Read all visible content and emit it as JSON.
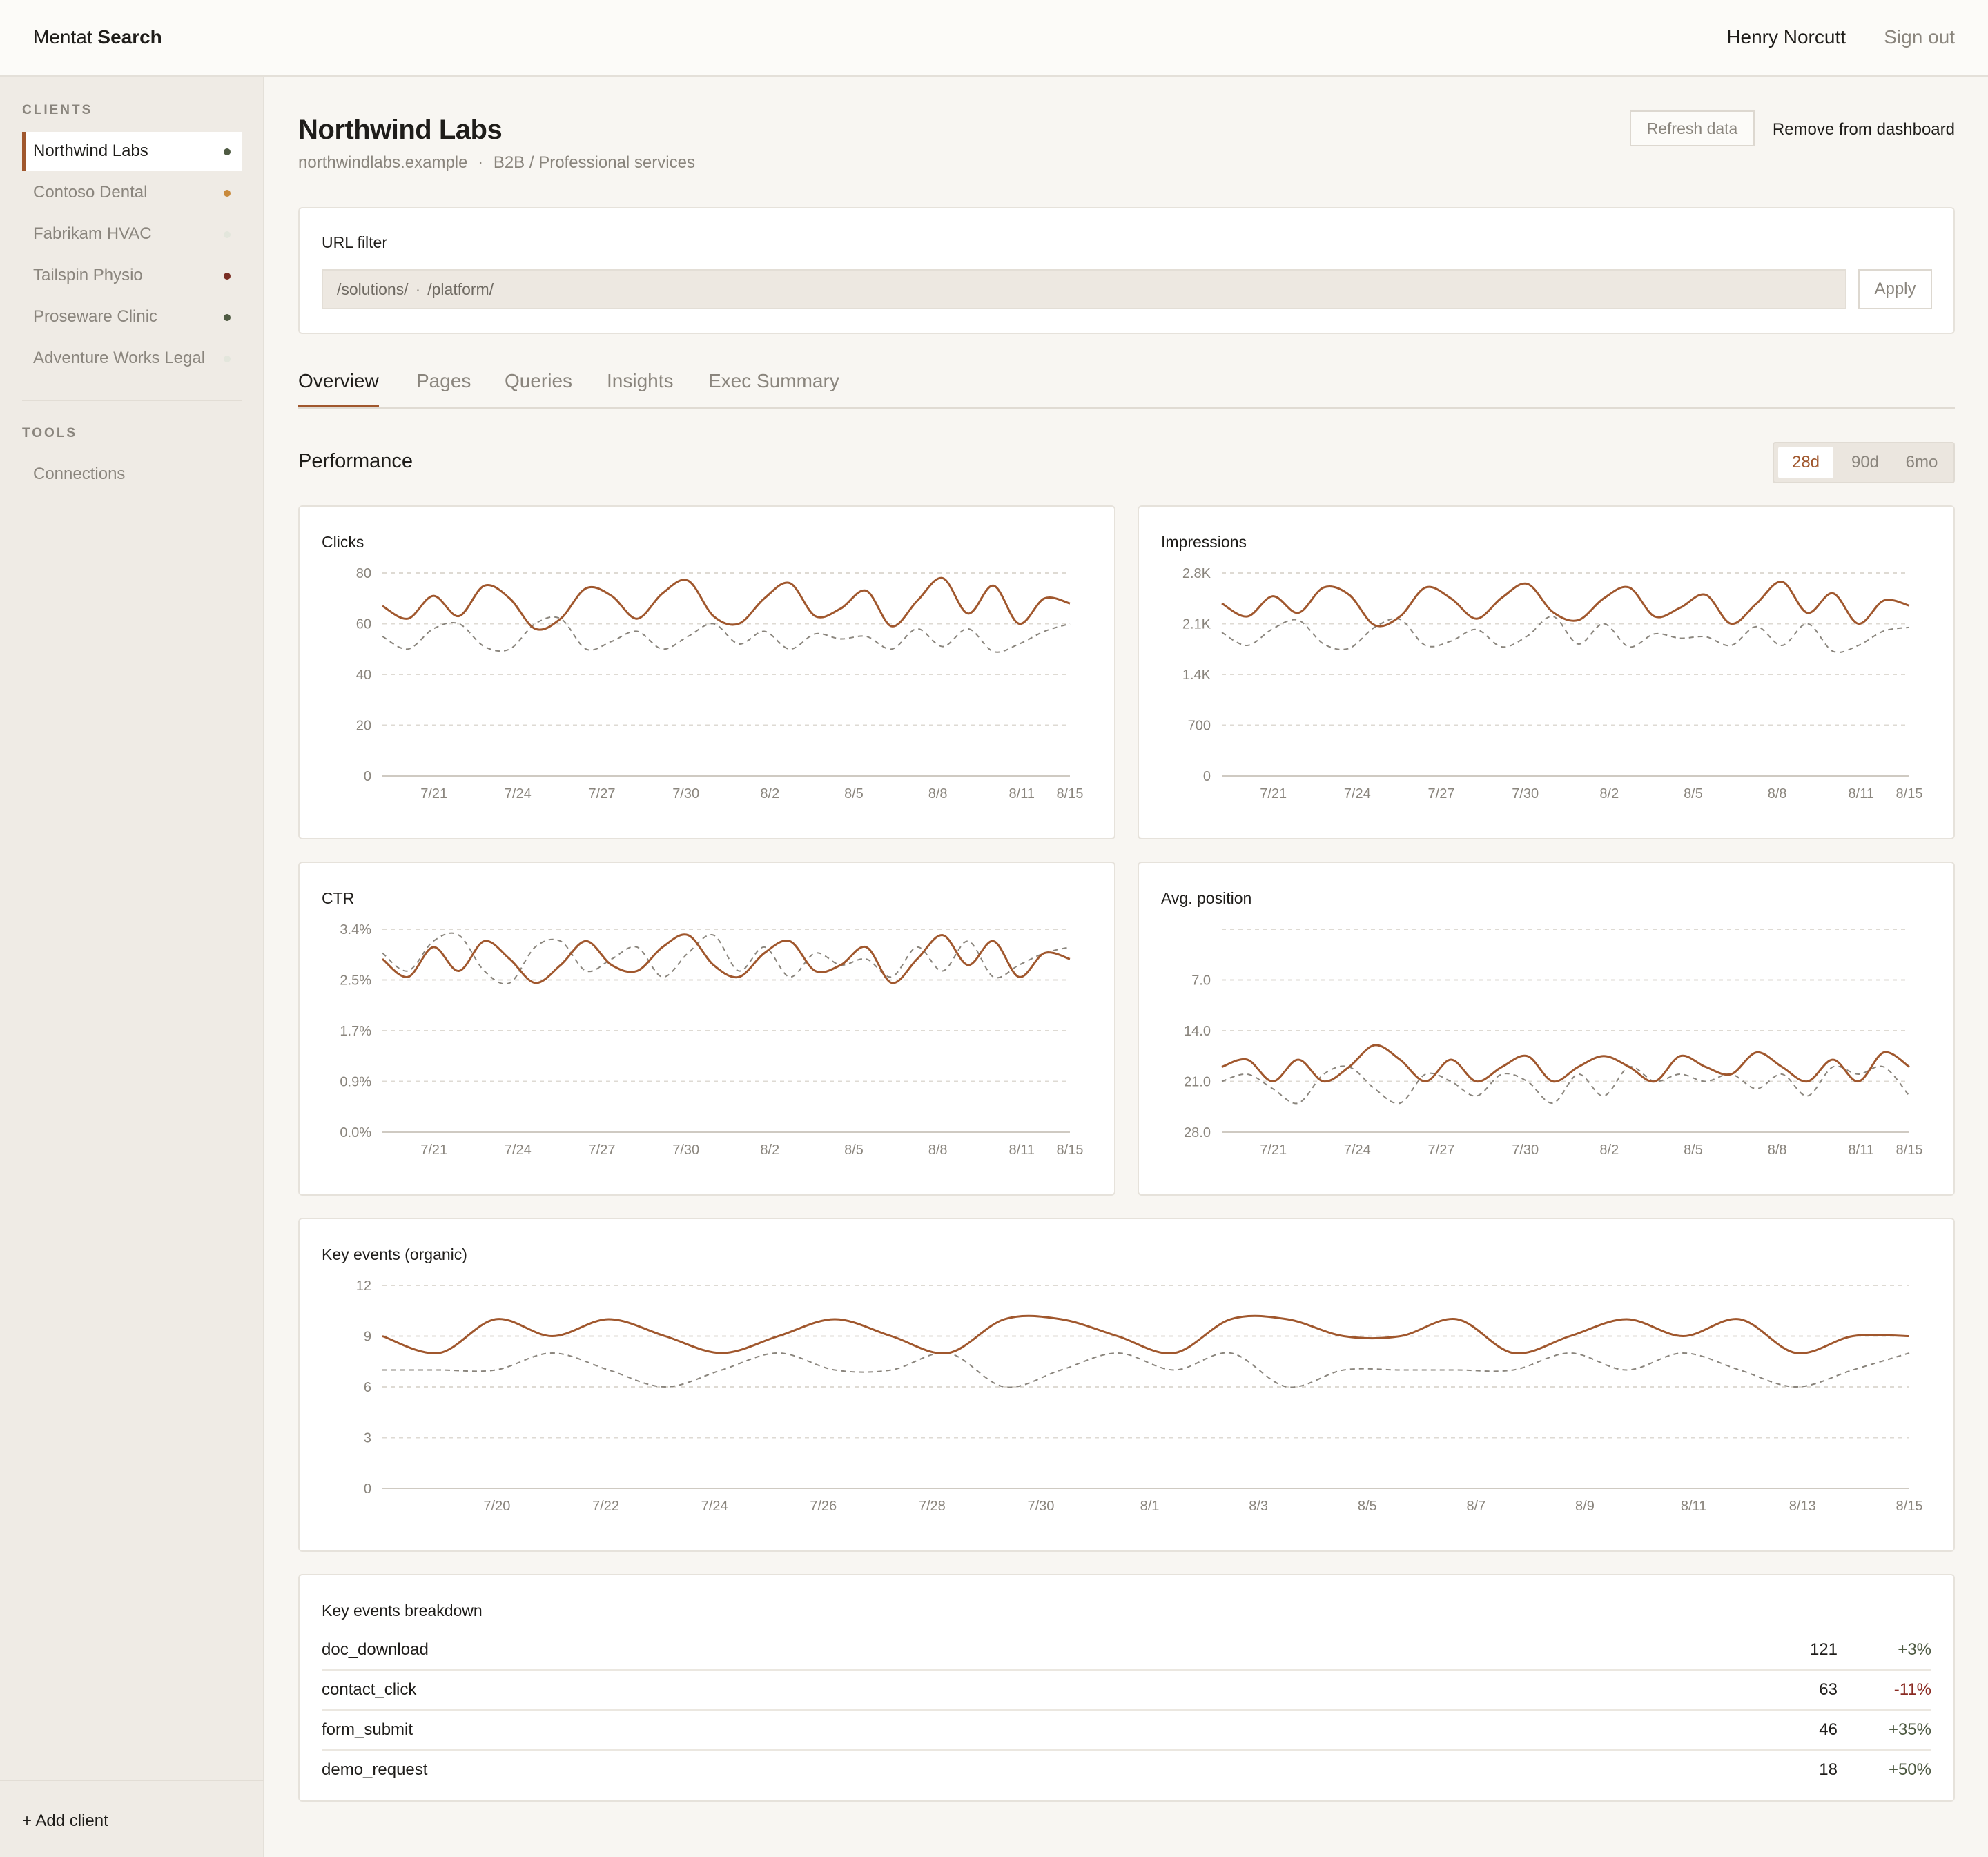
{
  "app": {
    "brand_left": "Mentat",
    "brand_right": "Search",
    "user_name": "Henry Norcutt",
    "sign_out": "Sign out"
  },
  "sidebar": {
    "clients_heading": "CLIENTS",
    "clients": [
      {
        "label": "Northwind Labs",
        "dot": "#4f5b43",
        "active": true
      },
      {
        "label": "Contoso Dental",
        "dot": "#c98a3c"
      },
      {
        "label": "Fabrikam HVAC",
        "dot": "#e3e6dc"
      },
      {
        "label": "Tailspin Physio",
        "dot": "#7a2e24"
      },
      {
        "label": "Proseware Clinic",
        "dot": "#4f5b43"
      },
      {
        "label": "Adventure Works Legal",
        "dot": "#e3e6dc"
      }
    ],
    "tools_heading": "TOOLS",
    "tools": [
      {
        "label": "Connections"
      }
    ],
    "add_client": "+ Add client"
  },
  "header": {
    "title": "Northwind Labs",
    "domain": "northwindlabs.example",
    "separator": "·",
    "category": "B2B / Professional services",
    "refresh_label": "Refresh data",
    "remove_label": "Remove from dashboard"
  },
  "url_filter": {
    "title": "URL filter",
    "value_1": "/solutions/",
    "separator": "·",
    "value_2": "/platform/",
    "apply_label": "Apply"
  },
  "tabs": [
    {
      "label": "Overview",
      "active": true
    },
    {
      "label": "Pages"
    },
    {
      "label": "Queries"
    },
    {
      "label": "Insights"
    },
    {
      "label": "Exec Summary"
    }
  ],
  "performance": {
    "title": "Performance",
    "ranges": [
      {
        "label": "28d",
        "active": true
      },
      {
        "label": "90d"
      },
      {
        "label": "6mo"
      }
    ]
  },
  "colors": {
    "accent": "#a0572d",
    "compare": "#8a857d",
    "grid": "#dedad3",
    "positive": "#4f5b43",
    "negative": "#8a2b22"
  },
  "chart_data": [
    {
      "type": "line",
      "title": "Clicks",
      "y_ticks": [
        "0",
        "20",
        "40",
        "60",
        "80"
      ],
      "ylim": [
        0,
        80
      ],
      "x_ticks": [
        "7/21",
        "7/24",
        "7/27",
        "7/30",
        "8/2",
        "8/5",
        "8/8",
        "8/11",
        "8/15"
      ],
      "series": [
        {
          "style": "solid",
          "values": [
            67,
            62,
            71,
            63,
            75,
            70,
            58,
            62,
            74,
            71,
            62,
            72,
            77,
            63,
            60,
            70,
            76,
            63,
            66,
            73,
            59,
            69,
            78,
            64,
            75,
            60,
            70,
            68
          ]
        },
        {
          "style": "dashed",
          "values": [
            55,
            50,
            58,
            60,
            51,
            50,
            60,
            62,
            50,
            53,
            57,
            50,
            55,
            60,
            52,
            57,
            50,
            56,
            54,
            55,
            50,
            58,
            51,
            58,
            49,
            52,
            57,
            60
          ]
        }
      ]
    },
    {
      "type": "line",
      "title": "Impressions",
      "y_ticks": [
        "0",
        "700",
        "1.4K",
        "2.1K",
        "2.8K"
      ],
      "ylim": [
        0,
        2800
      ],
      "x_ticks": [
        "7/21",
        "7/24",
        "7/27",
        "7/30",
        "8/2",
        "8/5",
        "8/8",
        "8/11",
        "8/15"
      ],
      "series": [
        {
          "style": "solid",
          "values": [
            2380,
            2200,
            2480,
            2250,
            2600,
            2500,
            2080,
            2200,
            2600,
            2450,
            2170,
            2460,
            2650,
            2260,
            2150,
            2450,
            2600,
            2200,
            2320,
            2500,
            2100,
            2380,
            2680,
            2250,
            2520,
            2100,
            2420,
            2350
          ]
        },
        {
          "style": "dashed",
          "values": [
            1980,
            1800,
            2030,
            2150,
            1820,
            1760,
            2050,
            2160,
            1800,
            1860,
            2020,
            1780,
            1930,
            2200,
            1820,
            2100,
            1780,
            1960,
            1900,
            1920,
            1800,
            2060,
            1800,
            2100,
            1720,
            1800,
            2000,
            2050
          ]
        }
      ]
    },
    {
      "type": "line",
      "title": "CTR",
      "y_ticks": [
        "0.0%",
        "0.9%",
        "1.7%",
        "2.5%",
        "3.4%"
      ],
      "ylim": [
        0,
        3.4
      ],
      "x_ticks": [
        "7/21",
        "7/24",
        "7/27",
        "7/30",
        "8/2",
        "8/5",
        "8/8",
        "8/11",
        "8/15"
      ],
      "series": [
        {
          "style": "solid",
          "values": [
            2.9,
            2.6,
            3.1,
            2.7,
            3.2,
            2.9,
            2.5,
            2.8,
            3.2,
            2.8,
            2.7,
            3.1,
            3.3,
            2.8,
            2.6,
            3.0,
            3.2,
            2.7,
            2.8,
            3.1,
            2.5,
            2.9,
            3.3,
            2.8,
            3.2,
            2.6,
            3.0,
            2.9
          ]
        },
        {
          "style": "dashed",
          "values": [
            3.0,
            2.7,
            3.2,
            3.3,
            2.7,
            2.5,
            3.1,
            3.2,
            2.7,
            2.9,
            3.1,
            2.6,
            3.0,
            3.3,
            2.7,
            3.1,
            2.6,
            3.0,
            2.8,
            2.9,
            2.6,
            3.1,
            2.7,
            3.2,
            2.6,
            2.8,
            3.0,
            3.1
          ]
        }
      ]
    },
    {
      "type": "line",
      "title": "Avg. position",
      "y_ticks": [
        "7.0",
        "14.0",
        "21.0",
        "28.0"
      ],
      "ylim": [
        28,
        0
      ],
      "x_ticks": [
        "7/21",
        "7/24",
        "7/27",
        "7/30",
        "8/2",
        "8/5",
        "8/8",
        "8/11",
        "8/15"
      ],
      "series": [
        {
          "style": "solid",
          "values": [
            19,
            18,
            21,
            18,
            21,
            19,
            16,
            18,
            21,
            18,
            21,
            19,
            17.5,
            21,
            19,
            17.5,
            19,
            21,
            17.5,
            19,
            20,
            17,
            19,
            21,
            18,
            21,
            17,
            19
          ]
        },
        {
          "style": "dashed",
          "values": [
            21,
            20,
            22,
            24,
            20,
            19,
            22,
            24,
            20,
            21,
            23,
            20,
            21,
            24,
            20,
            23,
            19,
            21,
            20,
            21,
            20,
            22,
            20,
            23,
            19,
            20,
            19,
            23
          ]
        }
      ]
    },
    {
      "type": "line",
      "title": "Key events (organic)",
      "y_ticks": [
        "0",
        "3",
        "6",
        "9",
        "12"
      ],
      "ylim": [
        0,
        12
      ],
      "x_ticks": [
        "7/20",
        "7/22",
        "7/24",
        "7/26",
        "7/28",
        "7/30",
        "8/1",
        "8/3",
        "8/5",
        "8/7",
        "8/9",
        "8/11",
        "8/13",
        "8/15"
      ],
      "series": [
        {
          "style": "solid",
          "values": [
            9,
            8,
            10,
            9,
            10,
            9,
            8,
            9,
            10,
            9,
            8,
            10,
            10,
            9,
            8,
            10,
            10,
            9,
            9,
            10,
            8,
            9,
            10,
            9,
            10,
            8,
            9,
            9
          ]
        },
        {
          "style": "dashed",
          "values": [
            7,
            7,
            7,
            8,
            7,
            6,
            7,
            8,
            7,
            7,
            8,
            6,
            7,
            8,
            7,
            8,
            6,
            7,
            7,
            7,
            7,
            8,
            7,
            8,
            7,
            6,
            7,
            8
          ]
        }
      ]
    }
  ],
  "breakdown": {
    "title": "Key events breakdown",
    "rows": [
      {
        "name": "doc_download",
        "value": "121",
        "change": "+3%",
        "dir": "up"
      },
      {
        "name": "contact_click",
        "value": "63",
        "change": "-11%",
        "dir": "down"
      },
      {
        "name": "form_submit",
        "value": "46",
        "change": "+35%",
        "dir": "up"
      },
      {
        "name": "demo_request",
        "value": "18",
        "change": "+50%",
        "dir": "up"
      }
    ]
  }
}
